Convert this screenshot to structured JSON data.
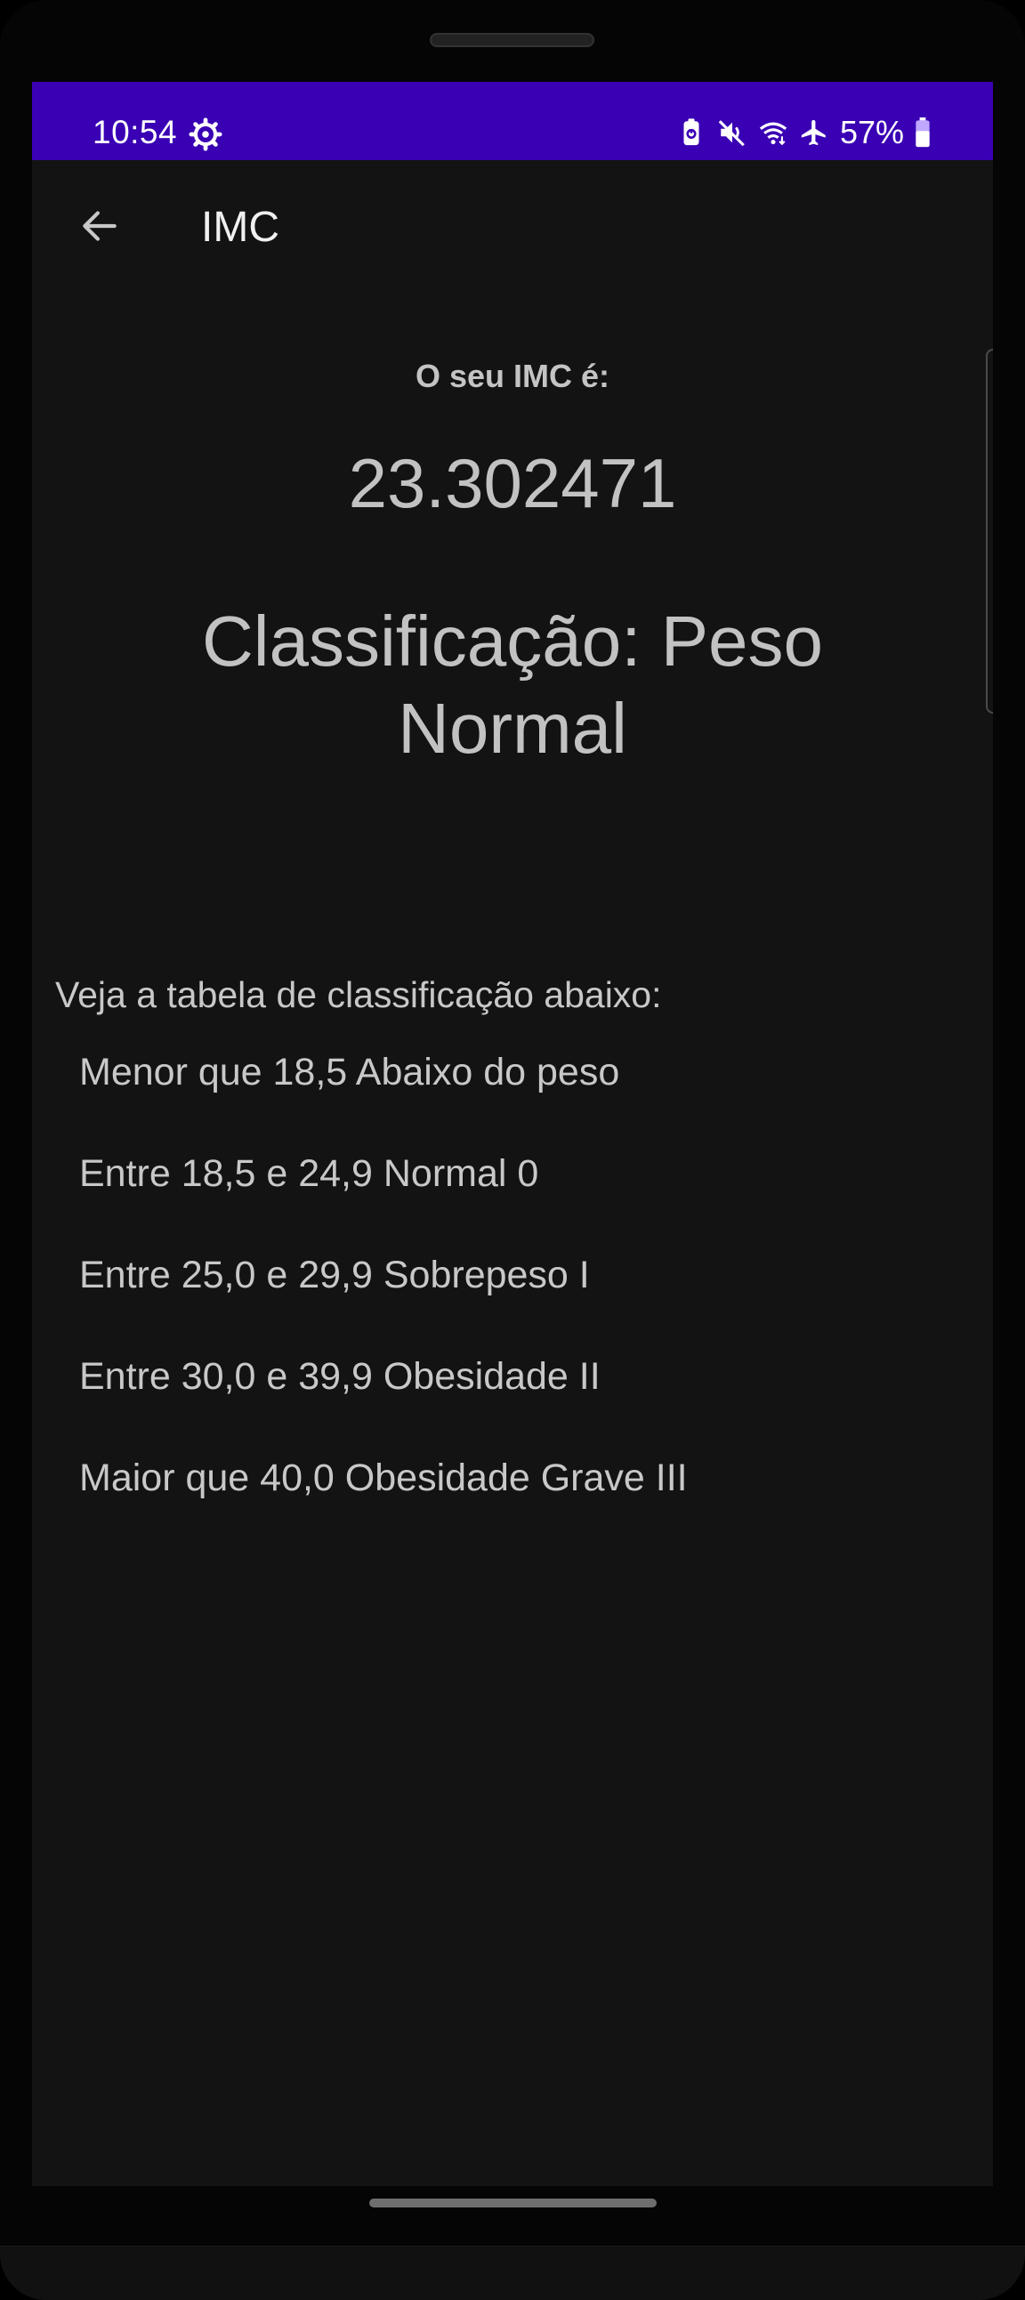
{
  "status_bar": {
    "time": "10:54",
    "battery_percent": "57%",
    "background": "#3a00b4",
    "left_icons": [
      "settings-icon"
    ],
    "right_icons": [
      "battery-saver-icon",
      "mute-icon",
      "wifi-icon",
      "airplane-icon",
      "battery-icon"
    ]
  },
  "app_bar": {
    "title": "IMC",
    "back_icon": "arrow-left-icon"
  },
  "result": {
    "label": "O seu IMC é:",
    "value": "23.302471",
    "classification": "Classificação: Peso Normal"
  },
  "table": {
    "heading": "Veja a tabela de classificação abaixo:",
    "rows": [
      "Menor que 18,5 Abaixo do peso",
      "Entre 18,5 e 24,9 Normal 0",
      "Entre 25,0 e 29,9 Sobrepeso I",
      "Entre 30,0 e 39,9 Obesidade II",
      "Maior que 40,0 Obesidade Grave III"
    ]
  },
  "colors": {
    "screen_background": "#131313",
    "text_primary": "#c4c4c4",
    "accent_status": "#3a00b4"
  }
}
